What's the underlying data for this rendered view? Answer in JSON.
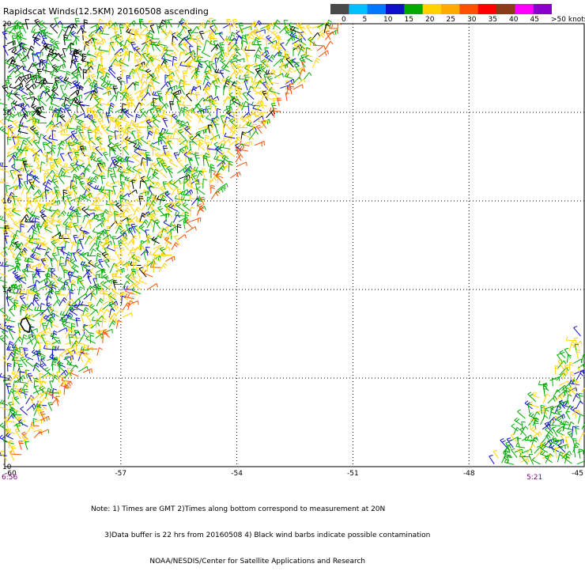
{
  "title": "Rapidscat Winds(12.5KM) 20160508 ascending",
  "legend": {
    "labels": [
      "0",
      "5",
      "10",
      "15",
      "20",
      "25",
      "30",
      "35",
      "40",
      "45",
      ">50 knots"
    ],
    "colors": [
      "#4a4a4a",
      "#00bfff",
      "#0078ff",
      "#1010cc",
      "#00aa00",
      "#ffd200",
      "#ffaa00",
      "#ff5000",
      "#ff0000",
      "#8b3a1a",
      "#ff00ff",
      "#8a00cc"
    ]
  },
  "axes": {
    "x_ticks": [
      "-60",
      "-57",
      "-54",
      "-51",
      "-48",
      "-45"
    ],
    "y_ticks": [
      "20",
      "18",
      "16",
      "14",
      "12",
      "10"
    ],
    "lon_range": [
      -60,
      -45
    ],
    "lat_range": [
      10,
      20
    ],
    "gridlines": true
  },
  "times": {
    "left": "6:56",
    "right": "5:21"
  },
  "note_lines": [
    "Note: 1) Times are GMT 2)Times along bottom correspond to measurement at 20N",
    "      3)Data buffer is 22 hrs from 20160508 4) Black wind barbs indicate possible contamination",
    "                          NOAA/NESDIS/Center for Satellite Applications and Research"
  ],
  "map": {
    "features": [
      "wind barbs",
      "island outline (Barbados)"
    ],
    "swath_colors": [
      "#00aa00",
      "#ffd200",
      "#1010cc",
      "#000000",
      "#ff5000"
    ]
  }
}
